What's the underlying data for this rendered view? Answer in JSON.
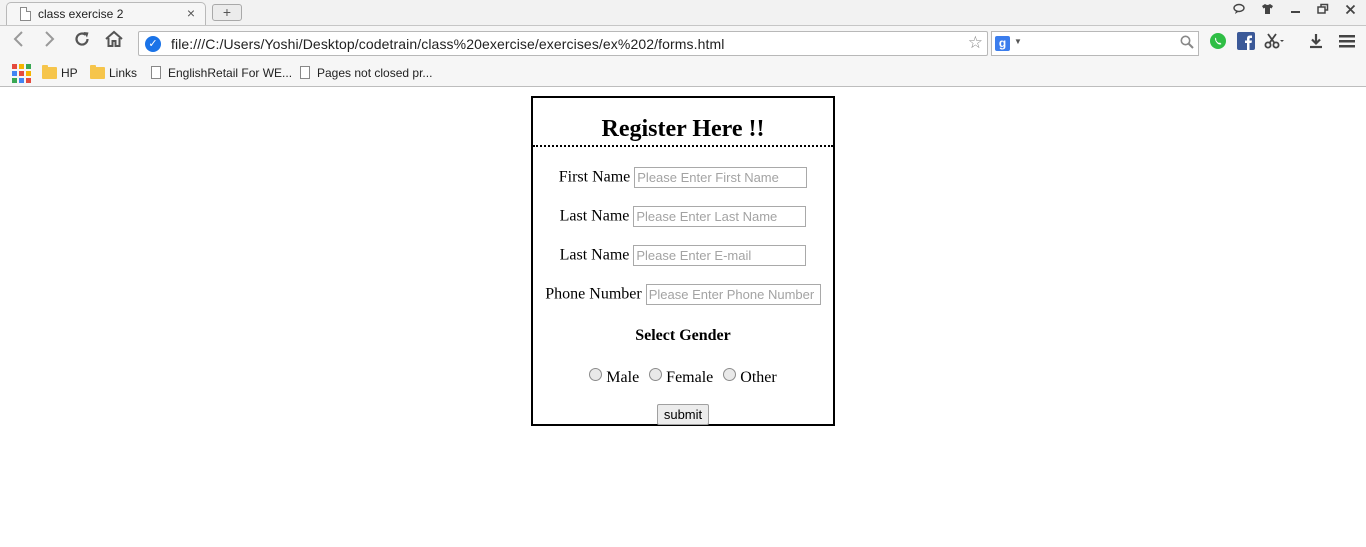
{
  "browser": {
    "tab_title": "class exercise 2",
    "tab_close": "×",
    "new_tab": "+",
    "url": "file:///C:/Users/Yoshi/Desktop/codetrain/class%20exercise/exercises/ex%202/forms.html",
    "bookmarks": [
      {
        "label": "HP",
        "icon": "folder-icon"
      },
      {
        "label": "Links",
        "icon": "folder-icon"
      },
      {
        "label": "EnglishRetail For WE...",
        "icon": "page-icon"
      },
      {
        "label": "Pages not closed pr...",
        "icon": "page-icon"
      }
    ],
    "accent_color": "#1a73e8"
  },
  "form": {
    "title": "Register Here !!",
    "fields": [
      {
        "label": "First Name",
        "placeholder": "Please Enter First Name"
      },
      {
        "label": "Last Name",
        "placeholder": "Please Enter Last Name"
      },
      {
        "label": "Last Name",
        "placeholder": "Please Enter E-mail"
      },
      {
        "label": "Phone Number",
        "placeholder": "Please Enter Phone Number"
      }
    ],
    "gender_heading": "Select Gender",
    "gender_options": [
      "Male",
      "Female",
      "Other"
    ],
    "submit_label": "submit"
  }
}
